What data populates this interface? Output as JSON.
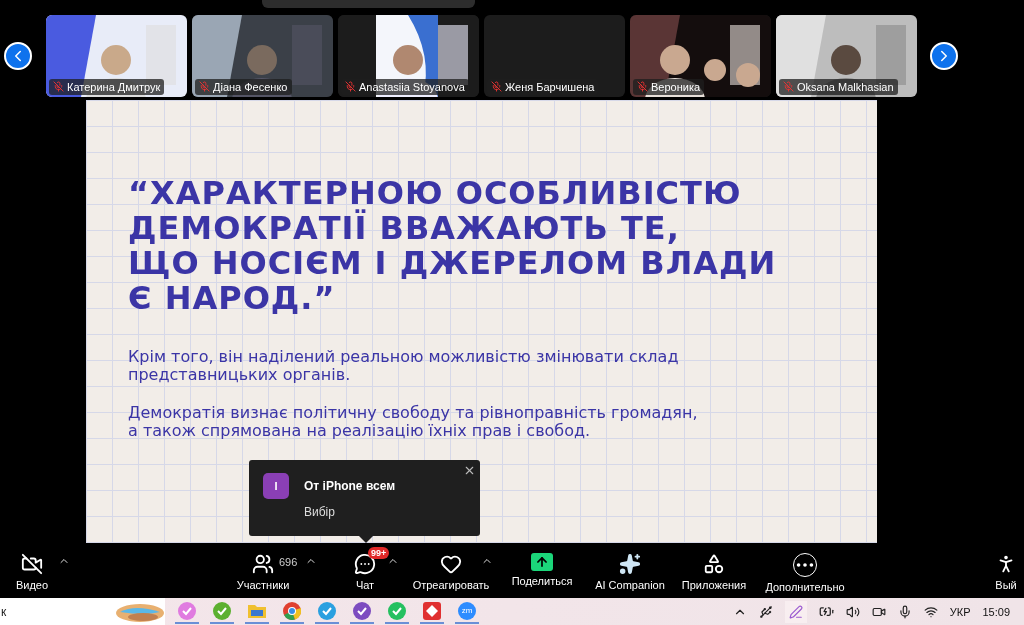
{
  "participants": [
    {
      "name": "Катерина Дмитрук",
      "muted": true,
      "video": true
    },
    {
      "name": "Діана Фесенко",
      "muted": true,
      "video": true
    },
    {
      "name": "Anastasiia Stoyanova",
      "muted": true,
      "video": true
    },
    {
      "name": "Женя Барчишена",
      "muted": true,
      "video": false
    },
    {
      "name": "Вероника",
      "muted": true,
      "video": true
    },
    {
      "name": "Oksana Malkhasian",
      "muted": true,
      "video": true
    }
  ],
  "slide": {
    "title_lines": [
      "“ХАРАКТЕРНОЮ ОСОБЛИВІСТЮ",
      "ДЕМОКРАТІЇ ВВАЖАЮТЬ ТЕ,",
      "ЩО НОСІЄМ І ДЖЕРЕЛОМ ВЛАДИ",
      "Є НАРОД.”"
    ],
    "paragraphs": [
      "Крім того, він наділений реальною можливістю змінювати склад представницьких органів.",
      "Демократія визнає політичну свободу та рівноправність громадян, а також спрямована на реалізацію їхніх прав і свобод."
    ]
  },
  "notification": {
    "avatar": "I",
    "title": "От iPhone всем",
    "message": "Вибір"
  },
  "toolbar": [
    {
      "kind": "video",
      "label": "Видео",
      "off": true,
      "caret": true
    },
    {
      "kind": "participants",
      "label": "Участники",
      "count": "696",
      "caret": true
    },
    {
      "kind": "chat",
      "label": "Чат",
      "badge": "99+",
      "caret": true
    },
    {
      "kind": "react",
      "label": "Отреагировать",
      "caret": true
    },
    {
      "kind": "share",
      "label": "Поделиться",
      "caret": false
    },
    {
      "kind": "ai",
      "label": "AI Companion",
      "caret": false
    },
    {
      "kind": "apps",
      "label": "Приложения",
      "caret": false
    },
    {
      "kind": "more",
      "label": "Дополнительно",
      "caret": false
    },
    {
      "kind": "leave",
      "label": "Вый",
      "caret": false
    }
  ],
  "taskbar": {
    "search": "к",
    "apps": [
      {
        "kind": "copilot"
      },
      {
        "kind": "torrent"
      },
      {
        "kind": "files"
      },
      {
        "kind": "chrome"
      },
      {
        "kind": "telegram"
      },
      {
        "kind": "viber"
      },
      {
        "kind": "whatsapp"
      },
      {
        "kind": "anydesk"
      },
      {
        "kind": "zoom",
        "label": "zm"
      }
    ],
    "language": "УКР",
    "time": "15:09"
  }
}
